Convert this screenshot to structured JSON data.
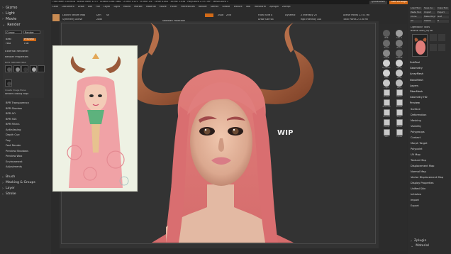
{
  "title_bar": {
    "app_info": "ZBrush 4R7 P3 (x64) · ZBrush Document · Free Mem 5.839GB · Active Mem 1273 · Scratch Disk 3862 · ZTime 1.071 · RTime 1.6 · Timer 0.001 · ATime 3.438 · PolyCount 2.571 MP · MeshCount 1",
    "quicksave": "QuickSave",
    "see_through": "See-through 0",
    "menus_btn": "Menus",
    "default_script": "DefaultZScript"
  },
  "menu_bar": [
    "Alpha",
    "Brush",
    "Color",
    "Document",
    "Draw",
    "Edit",
    "File",
    "Layer",
    "Light",
    "Macro",
    "Marker",
    "Material",
    "Movie",
    "Picker",
    "Preferences",
    "Render",
    "Stencil",
    "Stroke",
    "Texture",
    "Tool",
    "Transform",
    "Zplugin",
    "Zscript"
  ],
  "left_panel": {
    "sections": [
      "Gizmo",
      "Light",
      "Movie",
      "Render"
    ],
    "render_tabs": [
      "Cursor",
      "Render",
      "Best",
      "Preview",
      "Fast",
      "Flat"
    ],
    "render_items": [
      "External Renderer",
      "Render Properties",
      "BPR RenderPass"
    ],
    "render_icons": [
      "Shadow",
      "Depth",
      "AO",
      "Mask",
      "SSS",
      "Floor"
    ],
    "render_bpr_buttons": [
      "Create Image Plane",
      "Render Existing Maps"
    ],
    "sub_items": [
      "BPR Transparency",
      "BPR Shadow",
      "BPR AO",
      "BPR SSS",
      "BPR Filters",
      "Antialiasing",
      "Depth Cue",
      "Fog",
      "Fast Render",
      "Preview Shadows",
      "Preview Wax",
      "Environment",
      "Adjustments"
    ],
    "bottom_sections": [
      "Brush",
      "Masking & Groups",
      "Layer",
      "Stroke"
    ]
  },
  "toolbar": {
    "items": [
      "Launch Vellum Map",
      "Dyn",
      "Sk",
      "Symmetry Active",
      "Zadd",
      "Zsub",
      "Zcut",
      "Focal Shift 0",
      "Draw Size 64",
      "Dynamic",
      "Z Intensity 25",
      "Rgb Intensity 100",
      "Active Points 2.571 Mil",
      "Total Points 2.578 Mil"
    ],
    "spotlight": "Spotlight Projection",
    "coords": "-1.452, 0.452, 0.399"
  },
  "canvas": {
    "wip_label": "WIP"
  },
  "right_shelf": {
    "buttons": [
      "BPR",
      "SPix 3",
      "Scroll",
      "Zoom",
      "Actual",
      "AAHalf",
      "Dynamic",
      "Persp",
      "Floor",
      "Local",
      "L.Sym",
      "Gxyz",
      "Frame",
      "Move",
      "Zoom3D",
      "Rotate",
      "Line Fill",
      "PolyF",
      "Transp",
      "Ghost",
      "Solo",
      "Xpose"
    ]
  },
  "right_panel": {
    "header": [
      "Load Tool",
      "Save As",
      "Copy Tool",
      "Paste Tool",
      "Import",
      "Export",
      "Clone",
      "Make PolyMesh3D",
      "GoZ",
      "All",
      "Visible",
      "R"
    ],
    "tool_name": "LightBox> Tools",
    "tool_current": "Bulma Toon_Sq 48",
    "subtools": [
      "SubTool",
      "Geometry",
      "ArrayMesh",
      "NanoMesh",
      "Layers",
      "FiberMesh",
      "Geometry HD",
      "Preview"
    ],
    "items": [
      "Surface",
      "Deformation",
      "Masking",
      "Visibility",
      "Polygroups",
      "Contact",
      "Morph Target",
      "Polypaint",
      "UV Map",
      "Texture Map",
      "Displacement Map",
      "Normal Map",
      "Vector Displacement Map",
      "Display Properties",
      "Unified Skin",
      "Initialize",
      "Import",
      "Export"
    ],
    "bottom": [
      "Zplugin",
      "Material"
    ],
    "bottom_sub": [
      "Load",
      "Save",
      "LightBox> Materials",
      "SkinShade4 48"
    ]
  },
  "colors": {
    "accent": "#d26a17",
    "hair": "#e0807a",
    "horn": "#a85b38",
    "skin": "#e7b49b",
    "bg": "#333333"
  }
}
